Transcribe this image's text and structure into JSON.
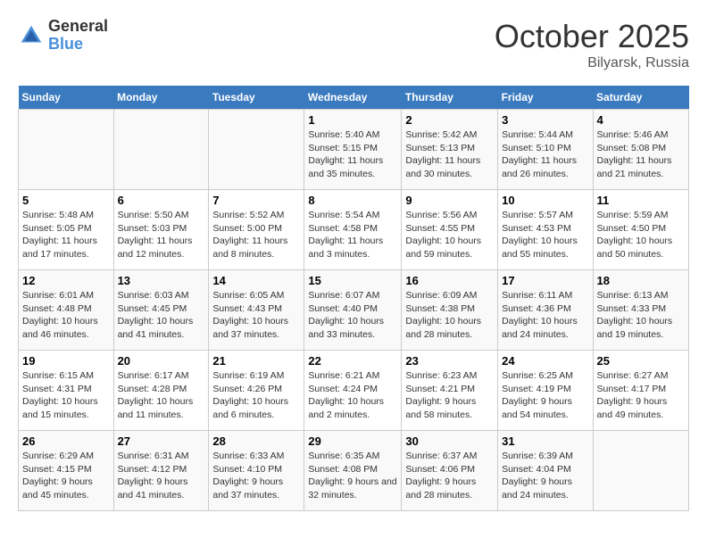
{
  "header": {
    "logo_general": "General",
    "logo_blue": "Blue",
    "month_title": "October 2025",
    "location": "Bilyarsk, Russia"
  },
  "days_of_week": [
    "Sunday",
    "Monday",
    "Tuesday",
    "Wednesday",
    "Thursday",
    "Friday",
    "Saturday"
  ],
  "weeks": [
    [
      {
        "day": "",
        "sunrise": "",
        "sunset": "",
        "daylight": ""
      },
      {
        "day": "",
        "sunrise": "",
        "sunset": "",
        "daylight": ""
      },
      {
        "day": "",
        "sunrise": "",
        "sunset": "",
        "daylight": ""
      },
      {
        "day": "1",
        "sunrise": "Sunrise: 5:40 AM",
        "sunset": "Sunset: 5:15 PM",
        "daylight": "Daylight: 11 hours and 35 minutes."
      },
      {
        "day": "2",
        "sunrise": "Sunrise: 5:42 AM",
        "sunset": "Sunset: 5:13 PM",
        "daylight": "Daylight: 11 hours and 30 minutes."
      },
      {
        "day": "3",
        "sunrise": "Sunrise: 5:44 AM",
        "sunset": "Sunset: 5:10 PM",
        "daylight": "Daylight: 11 hours and 26 minutes."
      },
      {
        "day": "4",
        "sunrise": "Sunrise: 5:46 AM",
        "sunset": "Sunset: 5:08 PM",
        "daylight": "Daylight: 11 hours and 21 minutes."
      }
    ],
    [
      {
        "day": "5",
        "sunrise": "Sunrise: 5:48 AM",
        "sunset": "Sunset: 5:05 PM",
        "daylight": "Daylight: 11 hours and 17 minutes."
      },
      {
        "day": "6",
        "sunrise": "Sunrise: 5:50 AM",
        "sunset": "Sunset: 5:03 PM",
        "daylight": "Daylight: 11 hours and 12 minutes."
      },
      {
        "day": "7",
        "sunrise": "Sunrise: 5:52 AM",
        "sunset": "Sunset: 5:00 PM",
        "daylight": "Daylight: 11 hours and 8 minutes."
      },
      {
        "day": "8",
        "sunrise": "Sunrise: 5:54 AM",
        "sunset": "Sunset: 4:58 PM",
        "daylight": "Daylight: 11 hours and 3 minutes."
      },
      {
        "day": "9",
        "sunrise": "Sunrise: 5:56 AM",
        "sunset": "Sunset: 4:55 PM",
        "daylight": "Daylight: 10 hours and 59 minutes."
      },
      {
        "day": "10",
        "sunrise": "Sunrise: 5:57 AM",
        "sunset": "Sunset: 4:53 PM",
        "daylight": "Daylight: 10 hours and 55 minutes."
      },
      {
        "day": "11",
        "sunrise": "Sunrise: 5:59 AM",
        "sunset": "Sunset: 4:50 PM",
        "daylight": "Daylight: 10 hours and 50 minutes."
      }
    ],
    [
      {
        "day": "12",
        "sunrise": "Sunrise: 6:01 AM",
        "sunset": "Sunset: 4:48 PM",
        "daylight": "Daylight: 10 hours and 46 minutes."
      },
      {
        "day": "13",
        "sunrise": "Sunrise: 6:03 AM",
        "sunset": "Sunset: 4:45 PM",
        "daylight": "Daylight: 10 hours and 41 minutes."
      },
      {
        "day": "14",
        "sunrise": "Sunrise: 6:05 AM",
        "sunset": "Sunset: 4:43 PM",
        "daylight": "Daylight: 10 hours and 37 minutes."
      },
      {
        "day": "15",
        "sunrise": "Sunrise: 6:07 AM",
        "sunset": "Sunset: 4:40 PM",
        "daylight": "Daylight: 10 hours and 33 minutes."
      },
      {
        "day": "16",
        "sunrise": "Sunrise: 6:09 AM",
        "sunset": "Sunset: 4:38 PM",
        "daylight": "Daylight: 10 hours and 28 minutes."
      },
      {
        "day": "17",
        "sunrise": "Sunrise: 6:11 AM",
        "sunset": "Sunset: 4:36 PM",
        "daylight": "Daylight: 10 hours and 24 minutes."
      },
      {
        "day": "18",
        "sunrise": "Sunrise: 6:13 AM",
        "sunset": "Sunset: 4:33 PM",
        "daylight": "Daylight: 10 hours and 19 minutes."
      }
    ],
    [
      {
        "day": "19",
        "sunrise": "Sunrise: 6:15 AM",
        "sunset": "Sunset: 4:31 PM",
        "daylight": "Daylight: 10 hours and 15 minutes."
      },
      {
        "day": "20",
        "sunrise": "Sunrise: 6:17 AM",
        "sunset": "Sunset: 4:28 PM",
        "daylight": "Daylight: 10 hours and 11 minutes."
      },
      {
        "day": "21",
        "sunrise": "Sunrise: 6:19 AM",
        "sunset": "Sunset: 4:26 PM",
        "daylight": "Daylight: 10 hours and 6 minutes."
      },
      {
        "day": "22",
        "sunrise": "Sunrise: 6:21 AM",
        "sunset": "Sunset: 4:24 PM",
        "daylight": "Daylight: 10 hours and 2 minutes."
      },
      {
        "day": "23",
        "sunrise": "Sunrise: 6:23 AM",
        "sunset": "Sunset: 4:21 PM",
        "daylight": "Daylight: 9 hours and 58 minutes."
      },
      {
        "day": "24",
        "sunrise": "Sunrise: 6:25 AM",
        "sunset": "Sunset: 4:19 PM",
        "daylight": "Daylight: 9 hours and 54 minutes."
      },
      {
        "day": "25",
        "sunrise": "Sunrise: 6:27 AM",
        "sunset": "Sunset: 4:17 PM",
        "daylight": "Daylight: 9 hours and 49 minutes."
      }
    ],
    [
      {
        "day": "26",
        "sunrise": "Sunrise: 6:29 AM",
        "sunset": "Sunset: 4:15 PM",
        "daylight": "Daylight: 9 hours and 45 minutes."
      },
      {
        "day": "27",
        "sunrise": "Sunrise: 6:31 AM",
        "sunset": "Sunset: 4:12 PM",
        "daylight": "Daylight: 9 hours and 41 minutes."
      },
      {
        "day": "28",
        "sunrise": "Sunrise: 6:33 AM",
        "sunset": "Sunset: 4:10 PM",
        "daylight": "Daylight: 9 hours and 37 minutes."
      },
      {
        "day": "29",
        "sunrise": "Sunrise: 6:35 AM",
        "sunset": "Sunset: 4:08 PM",
        "daylight": "Daylight: 9 hours and 32 minutes."
      },
      {
        "day": "30",
        "sunrise": "Sunrise: 6:37 AM",
        "sunset": "Sunset: 4:06 PM",
        "daylight": "Daylight: 9 hours and 28 minutes."
      },
      {
        "day": "31",
        "sunrise": "Sunrise: 6:39 AM",
        "sunset": "Sunset: 4:04 PM",
        "daylight": "Daylight: 9 hours and 24 minutes."
      },
      {
        "day": "",
        "sunrise": "",
        "sunset": "",
        "daylight": ""
      }
    ]
  ]
}
